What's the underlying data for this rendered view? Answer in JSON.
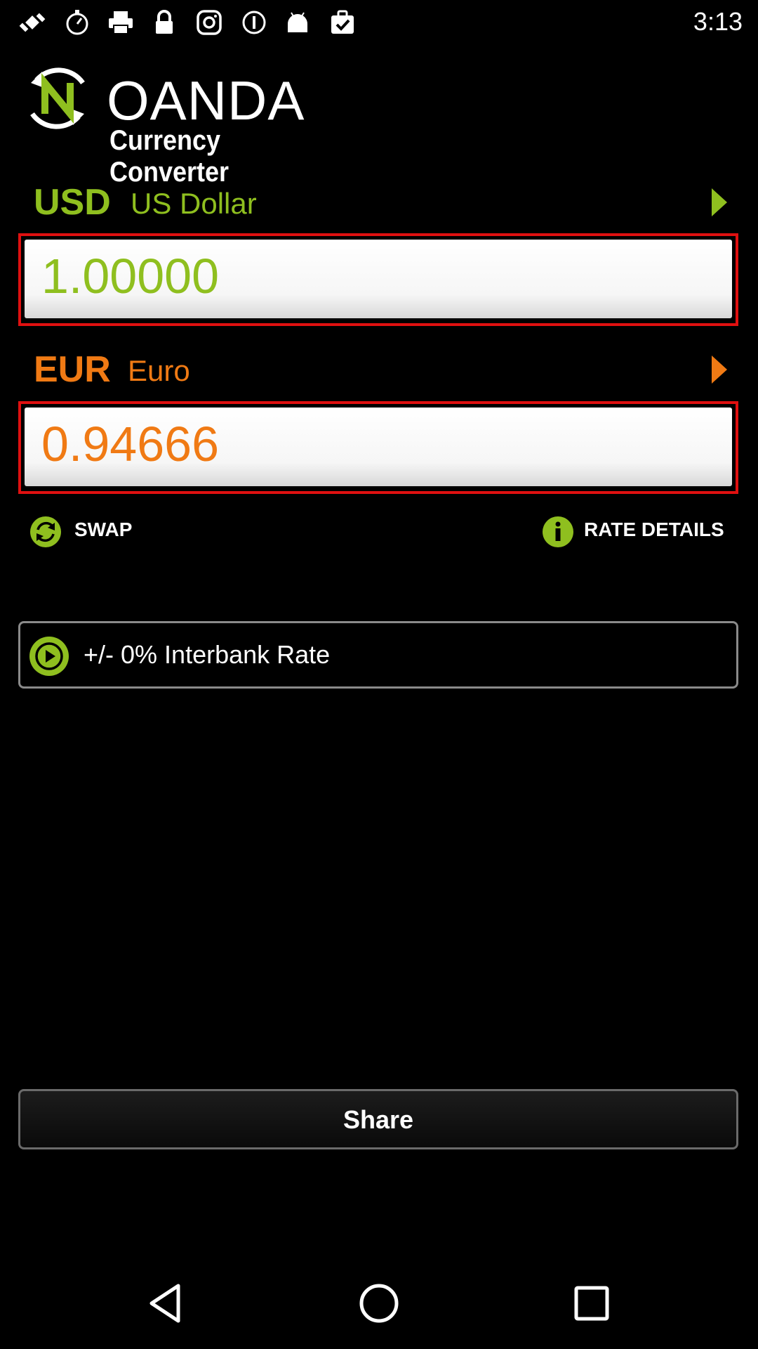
{
  "status_bar": {
    "time": "3:13",
    "icons": [
      "satellite-icon",
      "stopwatch-icon",
      "printer-icon",
      "lock-icon",
      "instagram-icon",
      "info-circle-icon",
      "android-icon",
      "checklist-icon"
    ]
  },
  "header": {
    "brand": "OANDA",
    "subtitle": "Currency Converter"
  },
  "from_currency": {
    "code": "USD",
    "name": "US Dollar",
    "amount": "1.00000",
    "color": "#8fbf1f"
  },
  "to_currency": {
    "code": "EUR",
    "name": "Euro",
    "amount": "0.94666",
    "color": "#f07a14"
  },
  "actions": {
    "swap_label": "SWAP",
    "rate_details_label": "RATE DETAILS"
  },
  "interbank": {
    "label": "+/- 0% Interbank Rate"
  },
  "share": {
    "label": "Share"
  },
  "colors": {
    "accent_green": "#8fbf1f",
    "accent_orange": "#f07a14",
    "box_border": "#e01010"
  }
}
